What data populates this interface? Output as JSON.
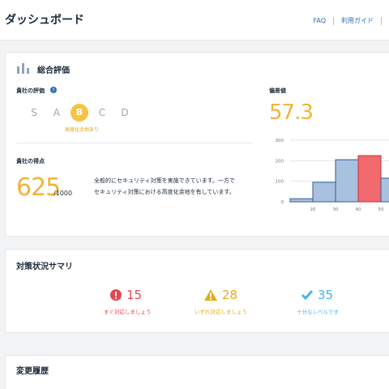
{
  "header": {
    "title": "ダッシュボード",
    "nav": [
      {
        "label": "FAQ"
      },
      {
        "label": "利用ガイド"
      }
    ]
  },
  "overall": {
    "title": "総合評価",
    "rating_label": "貴社の評価",
    "grades": [
      "S",
      "A",
      "B",
      "C",
      "D"
    ],
    "selected_grade": "B",
    "grade_note": "高度化余地あり",
    "score_label": "貴社の得点",
    "score": "625",
    "score_max": "/1000",
    "description_line1": "全般的にセキュリティ対策を実施できています。一方で",
    "description_line2": "セキュリティ対策における高度化余地を有しています。",
    "deviation_label": "偏差値",
    "deviation": "57.3"
  },
  "chart_data": {
    "type": "bar",
    "categories": [
      "10-20",
      "20-30",
      "30-40",
      "40-50",
      "50-60"
    ],
    "x_ticks": [
      "20",
      "30",
      "40",
      "50"
    ],
    "values": [
      15,
      95,
      205,
      225,
      115
    ],
    "highlight_index": 3,
    "ylim": [
      0,
      300
    ],
    "y_ticks": [
      "0",
      "100",
      "200",
      "300"
    ],
    "colors": {
      "bar": "#a9c1de",
      "bar_stroke": "#2f5d96",
      "highlight": "#f26a6e",
      "highlight_stroke": "#c1363d"
    }
  },
  "summary": {
    "title": "対策状況サマリ",
    "items": [
      {
        "icon": "exclamation-icon",
        "count": "15",
        "label": "すぐ対応しましょう",
        "color": "#e5484d"
      },
      {
        "icon": "warning-icon",
        "count": "28",
        "label": "いずれ対応しましょう",
        "color": "#e9a916"
      },
      {
        "icon": "check-icon",
        "count": "35",
        "label": "十分なレベルです",
        "color": "#45b5e4"
      }
    ]
  },
  "history": {
    "title": "変更履歴"
  }
}
